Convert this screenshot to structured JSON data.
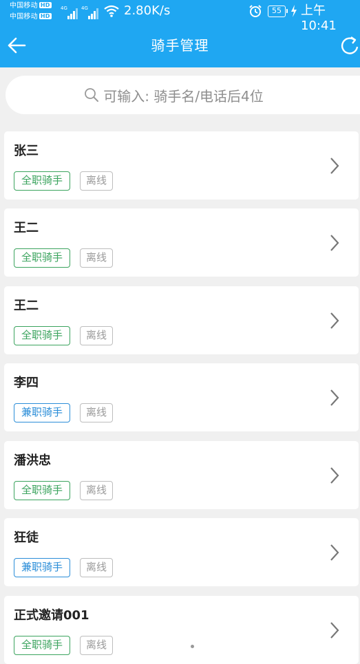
{
  "status_bar": {
    "carrier_1": "中国移动",
    "carrier_2": "中国移动",
    "hd_badge": "HD",
    "net_type": "4G",
    "net_speed": "2.80K/s",
    "battery_level": "55",
    "time": "上午10:41"
  },
  "header": {
    "title": "骑手管理",
    "back_icon": "arrow-left-icon",
    "refresh_icon": "refresh-icon",
    "background_color": "#1fa7f2"
  },
  "search": {
    "placeholder": "可输入: 骑手名/电话后4位",
    "icon": "search-icon"
  },
  "riders": [
    {
      "name": "张三",
      "role": "全职骑手",
      "role_type": "full",
      "status": "离线"
    },
    {
      "name": "王二",
      "role": "全职骑手",
      "role_type": "full",
      "status": "离线"
    },
    {
      "name": "王二",
      "role": "全职骑手",
      "role_type": "full",
      "status": "离线"
    },
    {
      "name": "李四",
      "role": "兼职骑手",
      "role_type": "part",
      "status": "离线"
    },
    {
      "name": "潘洪忠",
      "role": "全职骑手",
      "role_type": "full",
      "status": "离线"
    },
    {
      "name": "狂徒",
      "role": "兼职骑手",
      "role_type": "part",
      "status": "离线"
    },
    {
      "name": "正式邀请001",
      "role": "全职骑手",
      "role_type": "full",
      "status": "离线"
    }
  ],
  "colors": {
    "full_time_tag": "#3aa35d",
    "part_time_tag": "#2a8dd8",
    "offline_tag": "#9a9a9a",
    "page_background": "#f0f0f0"
  }
}
